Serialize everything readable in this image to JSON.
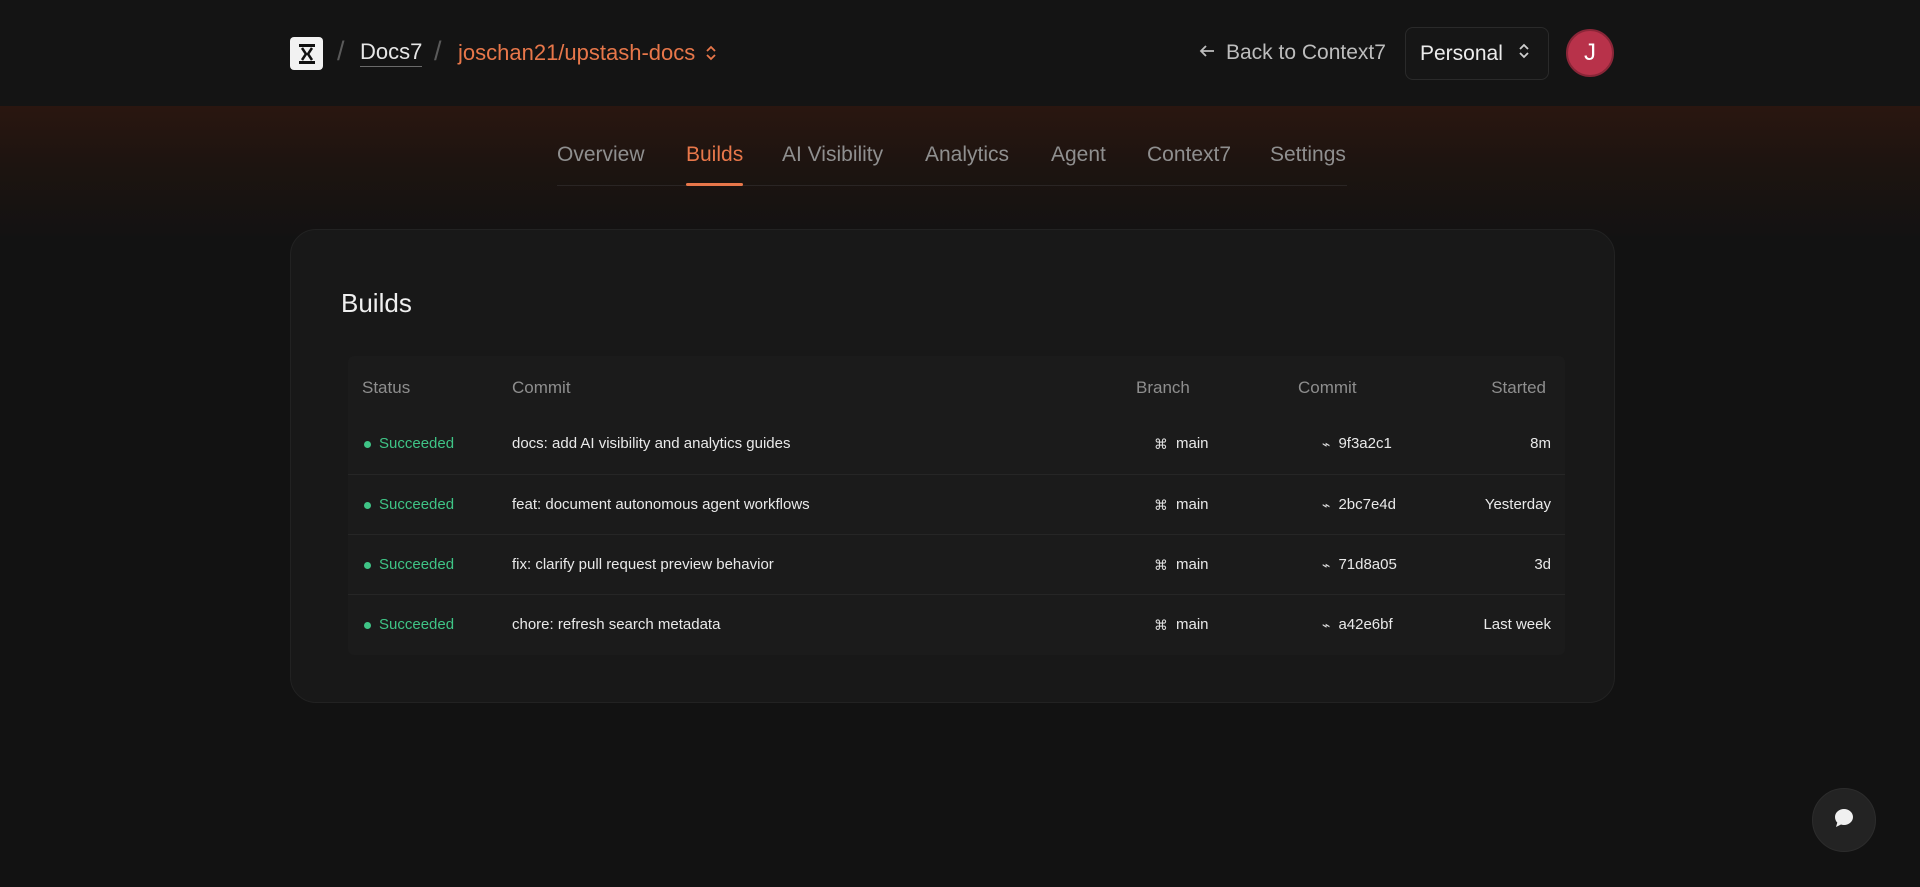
{
  "header": {
    "logo_icon": "docs-logo-icon",
    "breadcrumb": {
      "project": "Docs7",
      "repo": "joschan21/upstash-docs"
    },
    "back_link": "Back to Context7",
    "workspace": "Personal",
    "avatar_initial": "J"
  },
  "tabs": [
    {
      "label": "Overview"
    },
    {
      "label": "Builds",
      "active": true
    },
    {
      "label": "AI Visibility"
    },
    {
      "label": "Analytics"
    },
    {
      "label": "Agent"
    },
    {
      "label": "Context7"
    },
    {
      "label": "Settings"
    }
  ],
  "builds": {
    "title": "Builds",
    "columns": [
      "Status",
      "Commit",
      "Branch",
      "Commit",
      "Started"
    ],
    "rows": [
      {
        "status": "Succeeded",
        "message": "docs: add AI visibility and analytics guides",
        "branch": "main",
        "commit": "9f3a2c1",
        "started": "8m"
      },
      {
        "status": "Succeeded",
        "message": "feat: document autonomous agent workflows",
        "branch": "main",
        "commit": "2bc7e4d",
        "started": "Yesterday"
      },
      {
        "status": "Succeeded",
        "message": "fix: clarify pull request preview behavior",
        "branch": "main",
        "commit": "71d8a05",
        "started": "3d"
      },
      {
        "status": "Succeeded",
        "message": "chore: refresh search metadata",
        "branch": "main",
        "commit": "a42e6bf",
        "started": "Last week"
      }
    ]
  },
  "colors": {
    "accent": "#e8774a",
    "success": "#3fc486",
    "avatar": "#b8324a",
    "background": "#121212"
  }
}
